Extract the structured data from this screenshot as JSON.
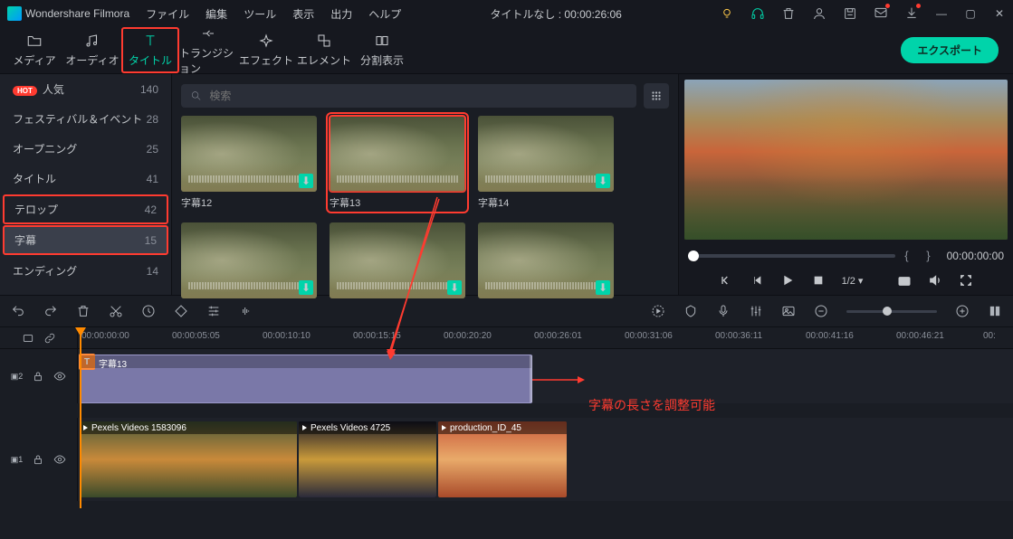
{
  "app_name": "Wondershare Filmora",
  "menu": [
    "ファイル",
    "編集",
    "ツール",
    "表示",
    "出力",
    "ヘルプ"
  ],
  "document_title": "タイトルなし : 00:00:26:06",
  "tabs": [
    {
      "label": "メディア"
    },
    {
      "label": "オーディオ"
    },
    {
      "label": "タイトル"
    },
    {
      "label": "トランジション"
    },
    {
      "label": "エフェクト"
    },
    {
      "label": "エレメント"
    },
    {
      "label": "分割表示"
    }
  ],
  "export_label": "エクスポート",
  "sidebar": [
    {
      "label": "人気",
      "count": 140,
      "hot": true
    },
    {
      "label": "フェスティバル＆イベント",
      "count": 28
    },
    {
      "label": "オープニング",
      "count": 25
    },
    {
      "label": "タイトル",
      "count": 41
    },
    {
      "label": "テロップ",
      "count": 42
    },
    {
      "label": "字幕",
      "count": 15,
      "active": true
    },
    {
      "label": "エンディング",
      "count": 14
    }
  ],
  "search_placeholder": "検索",
  "thumbs_row1": [
    "字幕12",
    "字幕13",
    "字幕14"
  ],
  "preview": {
    "braces": "{   }",
    "timecode": "00:00:00:00",
    "zoom": "1/2"
  },
  "ruler": [
    "00:00:00:00",
    "00:00:05:05",
    "00:00:10:10",
    "00:00:15:15",
    "00:00:20:20",
    "00:00:26:01",
    "00:00:31:06",
    "00:00:36:11",
    "00:00:41:16",
    "00:00:46:21",
    "00:"
  ],
  "title_clip": "字幕13",
  "clips": [
    "Pexels Videos 1583096",
    "Pexels Videos 4725",
    "production_ID_45"
  ],
  "annotation": "字幕の長さを調整可能",
  "track_labels": {
    "t2": "2",
    "t1": "1"
  }
}
